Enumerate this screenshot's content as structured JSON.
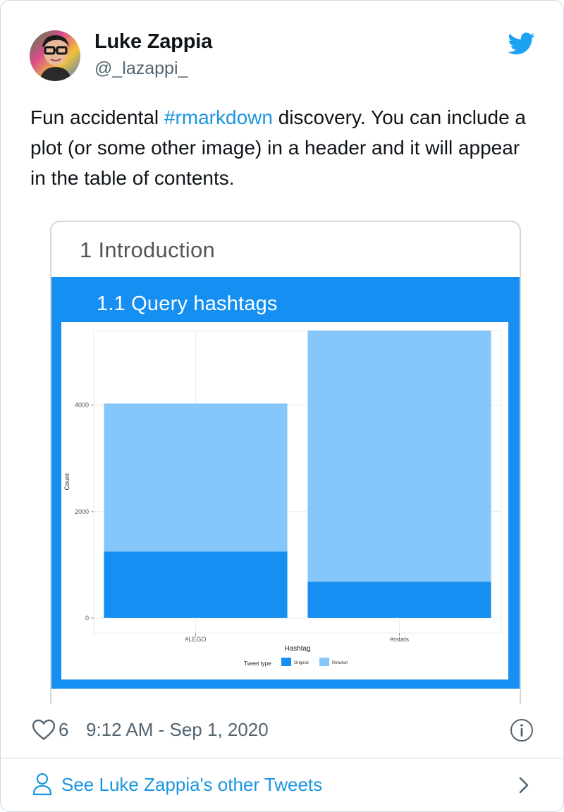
{
  "tweet": {
    "author_name": "Luke Zappia",
    "handle": "@_lazappi_",
    "text_before": "Fun accidental ",
    "hashtag": "#rmarkdown",
    "text_after": " discovery. You can include a plot (or some other image) in a header and it will appear in the table of contents.",
    "likes": "6",
    "timestamp": "9:12 AM - Sep 1, 2020",
    "see_more": "See Luke Zappia's other Tweets"
  },
  "icons": {
    "brand": "twitter-bird-icon",
    "like": "heart-icon",
    "info": "info-icon",
    "profile": "person-icon",
    "next": "chevron-right-icon"
  },
  "colors": {
    "brand_blue": "#1da1f2",
    "link_blue": "#1b95e0",
    "panel_blue": "#168ff2",
    "original_fill": "#168ff2",
    "retweet_fill": "#85c7fb"
  },
  "media": {
    "intro_heading": "1 Introduction",
    "sub_heading": "1.1 Query hashtags"
  },
  "chart_data": {
    "type": "bar",
    "stacked": true,
    "categories": [
      "#LEGO",
      "#rstats"
    ],
    "series": [
      {
        "name": "Original",
        "values": [
          1250,
          680
        ]
      },
      {
        "name": "Retweet",
        "values": [
          2780,
          4720
        ]
      }
    ],
    "xlabel": "Hashtag",
    "ylabel": "Count",
    "y_ticks": [
      0,
      2000,
      4000
    ],
    "ylim": [
      -280,
      5400
    ],
    "legend_title": "Tweet type",
    "legend_position": "bottom",
    "grid": true
  }
}
